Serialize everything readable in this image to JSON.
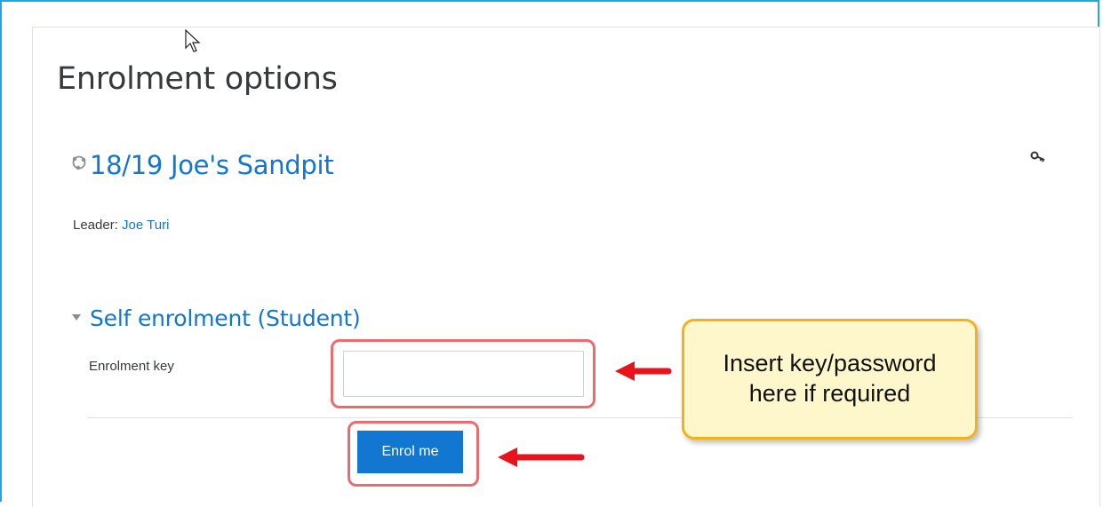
{
  "page": {
    "title": "Enrolment options"
  },
  "course": {
    "name": "18/19 Joe's Sandpit",
    "leader_label": "Leader:",
    "leader_name": "Joe Turi"
  },
  "self_enrolment": {
    "section_title": "Self enrolment (Student)",
    "key_label": "Enrolment key",
    "key_value": "",
    "enrol_button": "Enrol me"
  },
  "annotation": {
    "callout_line1": "Insert key/password",
    "callout_line2": "here if required"
  },
  "icons": {
    "course": "course-icon",
    "key": "key-icon",
    "collapse": "collapse-triangle-icon",
    "cursor": "mouse-cursor-icon",
    "arrow": "red-arrow-icon"
  },
  "colors": {
    "frame": "#1ea7e1",
    "link": "#1177d1",
    "button": "#1177d1",
    "highlight": "#ec6b6f",
    "callout_border": "#f2b21c",
    "callout_bg": "#fff7cc",
    "arrow": "#e8131c"
  }
}
